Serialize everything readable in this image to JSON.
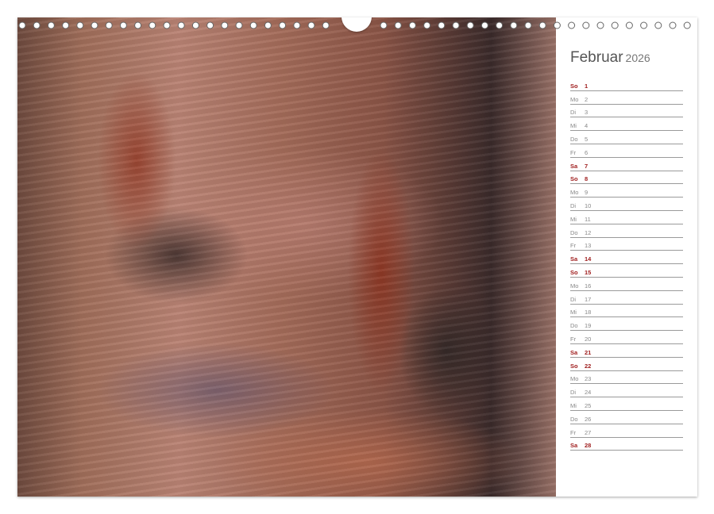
{
  "calendar": {
    "month": "Februar",
    "year": "2026",
    "days": [
      {
        "weekday": "So",
        "day": "1",
        "weekend": true
      },
      {
        "weekday": "Mo",
        "day": "2",
        "weekend": false
      },
      {
        "weekday": "Di",
        "day": "3",
        "weekend": false
      },
      {
        "weekday": "Mi",
        "day": "4",
        "weekend": false
      },
      {
        "weekday": "Do",
        "day": "5",
        "weekend": false
      },
      {
        "weekday": "Fr",
        "day": "6",
        "weekend": false
      },
      {
        "weekday": "Sa",
        "day": "7",
        "weekend": true
      },
      {
        "weekday": "So",
        "day": "8",
        "weekend": true
      },
      {
        "weekday": "Mo",
        "day": "9",
        "weekend": false
      },
      {
        "weekday": "Di",
        "day": "10",
        "weekend": false
      },
      {
        "weekday": "Mi",
        "day": "11",
        "weekend": false
      },
      {
        "weekday": "Do",
        "day": "12",
        "weekend": false
      },
      {
        "weekday": "Fr",
        "day": "13",
        "weekend": false
      },
      {
        "weekday": "Sa",
        "day": "14",
        "weekend": true
      },
      {
        "weekday": "So",
        "day": "15",
        "weekend": true
      },
      {
        "weekday": "Mo",
        "day": "16",
        "weekend": false
      },
      {
        "weekday": "Di",
        "day": "17",
        "weekend": false
      },
      {
        "weekday": "Mi",
        "day": "18",
        "weekend": false
      },
      {
        "weekday": "Do",
        "day": "19",
        "weekend": false
      },
      {
        "weekday": "Fr",
        "day": "20",
        "weekend": false
      },
      {
        "weekday": "Sa",
        "day": "21",
        "weekend": true
      },
      {
        "weekday": "So",
        "day": "22",
        "weekend": true
      },
      {
        "weekday": "Mo",
        "day": "23",
        "weekend": false
      },
      {
        "weekday": "Di",
        "day": "24",
        "weekend": false
      },
      {
        "weekday": "Mi",
        "day": "25",
        "weekend": false
      },
      {
        "weekday": "Do",
        "day": "26",
        "weekend": false
      },
      {
        "weekday": "Fr",
        "day": "27",
        "weekend": false
      },
      {
        "weekday": "Sa",
        "day": "28",
        "weekend": true
      }
    ]
  },
  "colors": {
    "weekend_text": "#a02020",
    "weekday_text": "#888888",
    "rule_line": "#9a9a9a"
  },
  "photo": {
    "subject": "birch-bark-closeup"
  }
}
